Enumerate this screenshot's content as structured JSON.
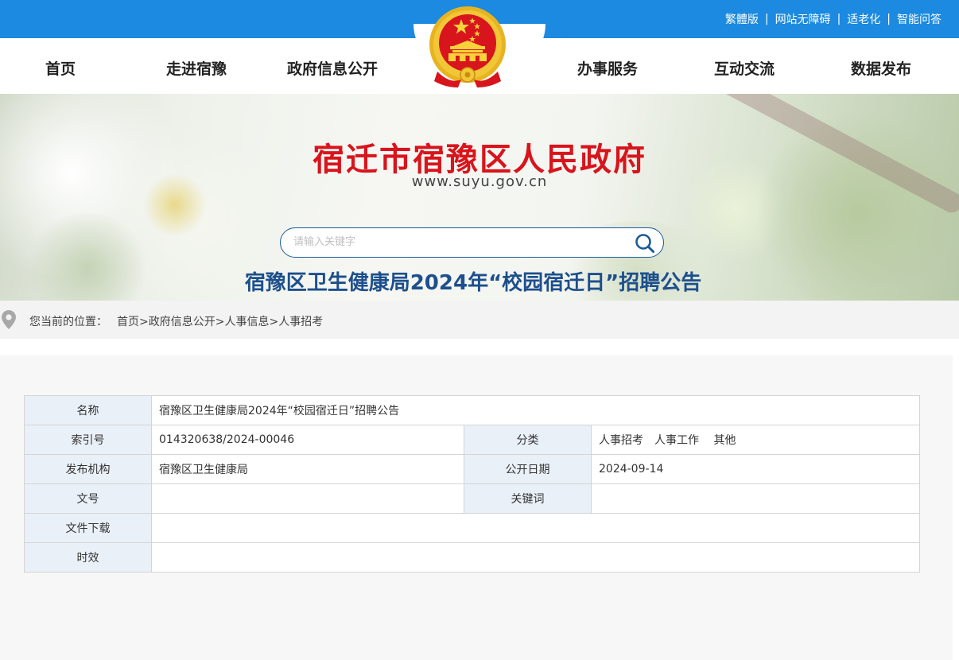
{
  "top_links": [
    "繁體版",
    "网站无障碍",
    "适老化",
    "智能问答"
  ],
  "top_separator": "|",
  "nav": {
    "items": [
      "首页",
      "走进宿豫",
      "政府信息公开",
      "办事服务",
      "互动交流",
      "数据发布"
    ]
  },
  "banner": {
    "title": "宿迁市宿豫区人民政府",
    "url": "www.suyu.gov.cn",
    "search_placeholder": "请输入关键字"
  },
  "breadcrumb": {
    "label": "您当前的位置：",
    "items": [
      "首页",
      "政府信息公开",
      "人事信息",
      "人事招考"
    ],
    "separator": ">"
  },
  "meta": {
    "name_label": "名称",
    "name_value": "宿豫区卫生健康局2024年“校园宿迁日”招聘公告",
    "index_label": "索引号",
    "index_value": "014320638/2024-00046",
    "category_label": "分类",
    "category_value": "人事招考　人事工作　 其他",
    "publisher_label": "发布机构",
    "publisher_value": "宿豫区卫生健康局",
    "date_label": "公开日期",
    "date_value": "2024-09-14",
    "docno_label": "文号",
    "docno_value": "",
    "keywords_label": "关键词",
    "keywords_value": "",
    "download_label": "文件下载",
    "download_value": "",
    "validity_label": "时效",
    "validity_value": ""
  },
  "article": {
    "title": "宿豫区卫生健康局2024年“校园宿迁日”招聘公告"
  },
  "colors": {
    "top_bar": "#1b8ae0",
    "site_title": "#d8141c",
    "article_title": "#1d4f8c",
    "label_cell_bg": "#eaf0f8"
  },
  "icons": [
    "national-emblem-icon",
    "search-icon",
    "location-pin-icon"
  ]
}
